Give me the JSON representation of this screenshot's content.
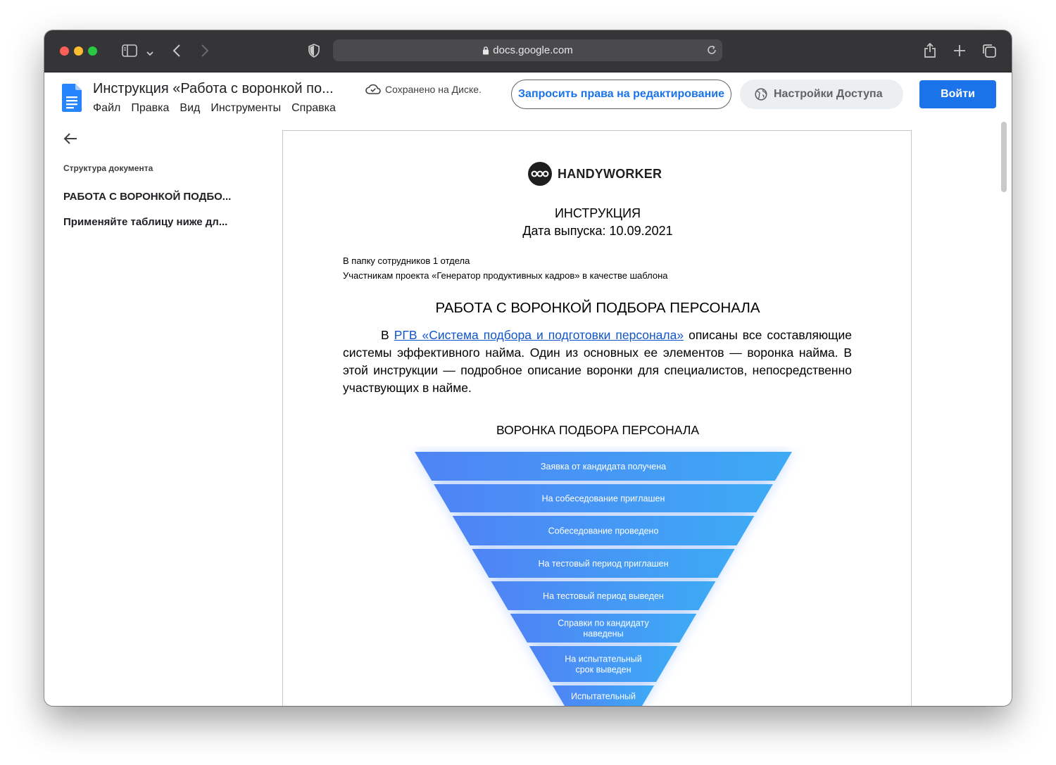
{
  "browser": {
    "url": "docs.google.com"
  },
  "docs_header": {
    "title": "Инструкция «Работа с воронкой по...",
    "menu": [
      "Файл",
      "Правка",
      "Вид",
      "Инструменты",
      "Справка"
    ],
    "saved_status": "Сохранено на Диске.",
    "request_edit_button": "Запросить права на редактирование",
    "access_settings_button": "Настройки Доступа",
    "login_button": "Войти"
  },
  "outline": {
    "title": "Структура документа",
    "items": [
      "РАБОТА С ВОРОНКОЙ ПОДБО...",
      "Применяйте таблицу ниже дл..."
    ]
  },
  "document": {
    "logo_text": "HANDYWORKER",
    "doc_type": "ИНСТРУКЦИЯ",
    "release_date": "Дата выпуска: 10.09.2021",
    "distribution_line_1": "В папку сотрудников 1 отдела",
    "distribution_line_2": "Участникам проекта «Генератор продуктивных кадров» в качестве шаблона",
    "heading": "РАБОТА С ВОРОНКОЙ ПОДБОРА ПЕРСОНАЛА",
    "para_prefix": "В",
    "para_link": "РГВ «Система подбора и подготовки персонала»",
    "para_rest": "описаны все составляющие системы эффективного найма. Один из основных ее элементов — воронка найма. В этой инструкции — подробное описание воронки для специалистов, непосредственно участвующих в найме.",
    "funnel_title": "ВОРОНКА ПОДБОРА ПЕРСОНАЛА",
    "funnel_stages": [
      [
        "Заявка от кандидата получена"
      ],
      [
        "На собеседование приглашен"
      ],
      [
        "Собеседование проведено"
      ],
      [
        "На тестовый период приглашен"
      ],
      [
        "На тестовый период выведен"
      ],
      [
        "Справки по кандидату",
        "наведены"
      ],
      [
        "На испытательный",
        "срок выведен"
      ],
      [
        "Испытательный"
      ]
    ]
  },
  "colors": {
    "brand_blue": "#1a73e8",
    "link_blue": "#1155cc",
    "funnel_left": "#4f84f5",
    "funnel_right": "#3daaf5"
  }
}
